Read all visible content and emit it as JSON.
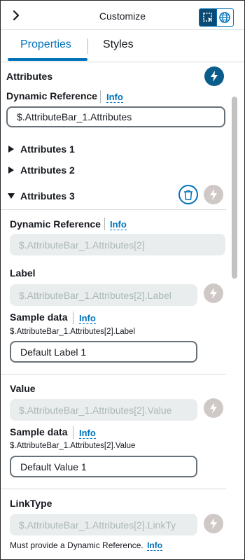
{
  "header": {
    "title": "Customize"
  },
  "tabs": {
    "properties": "Properties",
    "styles": "Styles"
  },
  "attributes": {
    "heading": "Attributes",
    "dynamic_reference_label": "Dynamic Reference",
    "info": "Info",
    "dynamic_reference_value": "$.AttributeBar_1.Attributes",
    "groups": [
      "Attributes 1",
      "Attributes 2",
      "Attributes 3"
    ]
  },
  "attr3": {
    "dynamic_reference_label": "Dynamic Reference",
    "info": "Info",
    "dynamic_reference_value": "$.AttributeBar_1.Attributes[2]",
    "label_heading": "Label",
    "label_value": "$.AttributeBar_1.Attributes[2].Label",
    "label_sample_heading": "Sample data",
    "label_sample_info": "Info",
    "label_sample_path": "$.AttributeBar_1.Attributes[2].Label",
    "label_sample_value": "Default Label 1",
    "value_heading": "Value",
    "value_value": "$.AttributeBar_1.Attributes[2].Value",
    "value_sample_heading": "Sample data",
    "value_sample_info": "Info",
    "value_sample_path": "$.AttributeBar_1.Attributes[2].Value",
    "value_sample_value": "Default Value 1",
    "linktype_heading": "LinkType",
    "linktype_value": "$.AttributeBar_1.Attributes[2].LinkTy",
    "linktype_note": "Must provide a Dynamic Reference.",
    "linktype_info": "Info"
  },
  "colors": {
    "accent": "#0073bb",
    "bolt_active": "#0a5c8a",
    "bolt_inactive": "#cfc8c6",
    "disabled_bg": "#eaeded"
  },
  "icons": [
    "chevron-right-icon",
    "select-region-icon",
    "globe-icon",
    "bolt-icon",
    "trash-icon",
    "caret-right-icon",
    "caret-down-icon"
  ]
}
